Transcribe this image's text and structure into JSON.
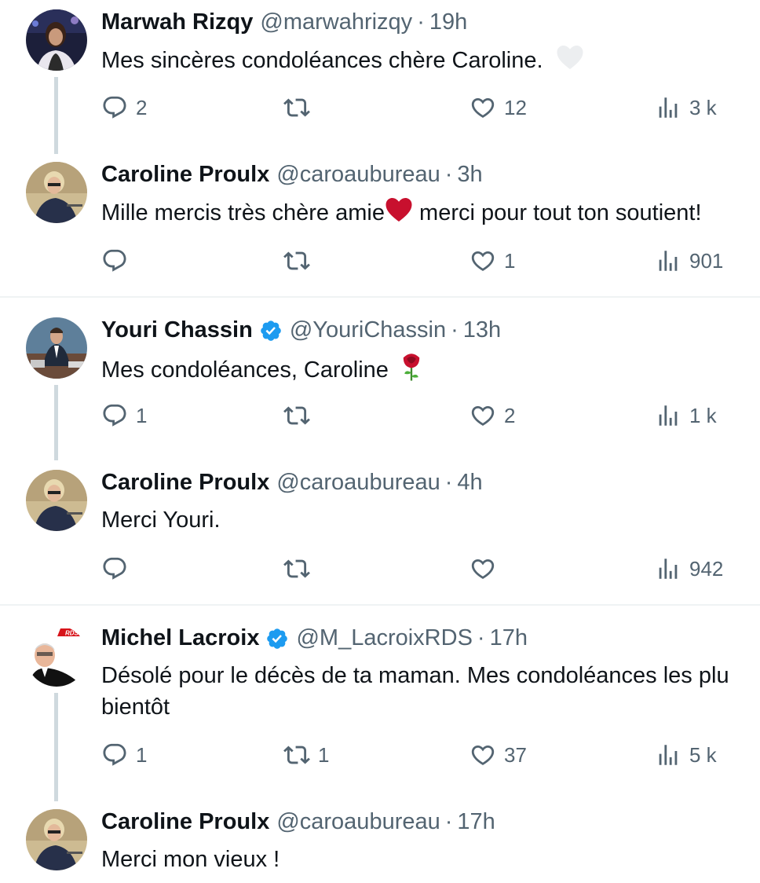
{
  "tweets": [
    {
      "name": "Marwah Rizqy",
      "handle": "@marwahrizqy",
      "sep": "·",
      "time": "19h",
      "verified": false,
      "text": "Mes sincères condoléances chère Caroline.",
      "emoji_after": "white-heart",
      "replies": "2",
      "retweets": "",
      "likes": "12",
      "views": "3 k"
    },
    {
      "name": "Caroline Proulx",
      "handle": "@caroaubureau",
      "sep": "·",
      "time": "3h",
      "verified": false,
      "text_part1": "Mille mercis très chère amie",
      "emoji_mid": "red-heart",
      "text_part2": " merci pour tout ton soutient!",
      "replies": "",
      "retweets": "",
      "likes": "1",
      "views": "901"
    },
    {
      "name": "Youri Chassin",
      "handle": "@YouriChassin",
      "sep": "·",
      "time": "13h",
      "verified": true,
      "text": "Mes condoléances, Caroline",
      "emoji_after": "rose",
      "replies": "1",
      "retweets": "",
      "likes": "2",
      "views": "1 k"
    },
    {
      "name": "Caroline Proulx",
      "handle": "@caroaubureau",
      "sep": "·",
      "time": "4h",
      "verified": false,
      "text": "Merci Youri.",
      "replies": "",
      "retweets": "",
      "likes": "",
      "views": "942"
    },
    {
      "name": "Michel Lacroix",
      "handle": "@M_LacroixRDS",
      "sep": "·",
      "time": "17h",
      "verified": true,
      "text_line1": "Désolé pour le décès de ta maman. Mes condoléances les plu",
      "text_line2": "bientôt",
      "replies": "1",
      "retweets": "1",
      "likes": "37",
      "views": "5 k",
      "avatar_logo_text": "RDS"
    },
    {
      "name": "Caroline Proulx",
      "handle": "@caroaubureau",
      "sep": "·",
      "time": "17h",
      "verified": false,
      "text": "Merci mon vieux !"
    }
  ],
  "colors": {
    "text": "#0f1419",
    "secondary": "#536471",
    "thread_line": "#cfd9de",
    "separator": "#eff3f4",
    "verified_blue": "#1d9bf0"
  },
  "icons": [
    "reply-icon",
    "retweet-icon",
    "like-icon",
    "views-icon",
    "verified-badge-icon"
  ]
}
